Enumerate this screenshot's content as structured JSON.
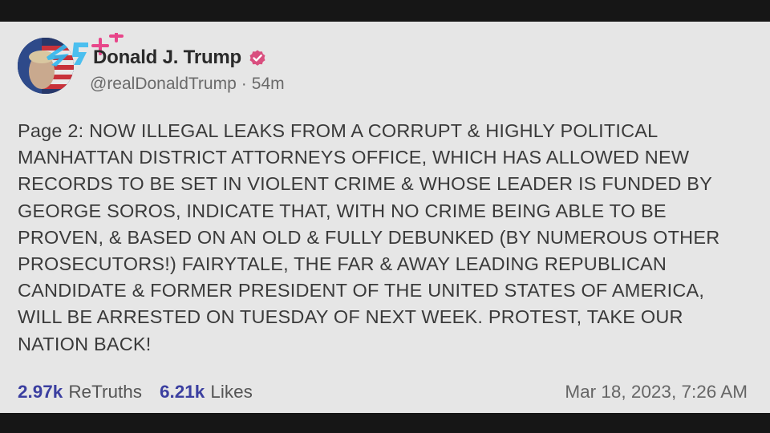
{
  "post": {
    "display_name": "Donald J. Trump",
    "verified_icon": "verified-badge-icon",
    "handle": "@realDonaldTrump",
    "separator": "·",
    "age": "54m",
    "text": "Page 2: NOW ILLEGAL LEAKS FROM A CORRUPT & HIGHLY POLITICAL\nMANHATTAN DISTRICT ATTORNEYS OFFICE, WHICH HAS ALLOWED NEW\nRECORDS TO BE SET IN VIOLENT CRIME & WHOSE LEADER IS FUNDED BY\nGEORGE SOROS, INDICATE THAT, WITH NO CRIME BEING ABLE TO BE\nPROVEN, & BASED ON AN OLD & FULLY DEBUNKED (BY NUMEROUS OTHER\nPROSECUTORS!) FAIRYTALE, THE FAR & AWAY LEADING REPUBLICAN\nCANDIDATE & FORMER PRESIDENT OF THE UNITED STATES OF AMERICA,\nWILL BE ARRESTED ON TUESDAY OF NEXT WEEK. PROTEST, TAKE OUR\nNATION BACK!",
    "retruths_count": "2.97k",
    "retruths_label": "ReTruths",
    "likes_count": "6.21k",
    "likes_label": "Likes",
    "timestamp": "Mar 18, 2023, 7:26 AM"
  },
  "colors": {
    "accent": "#3b3fa0",
    "verified": "#d94f7f",
    "background": "#e6e6e6"
  }
}
